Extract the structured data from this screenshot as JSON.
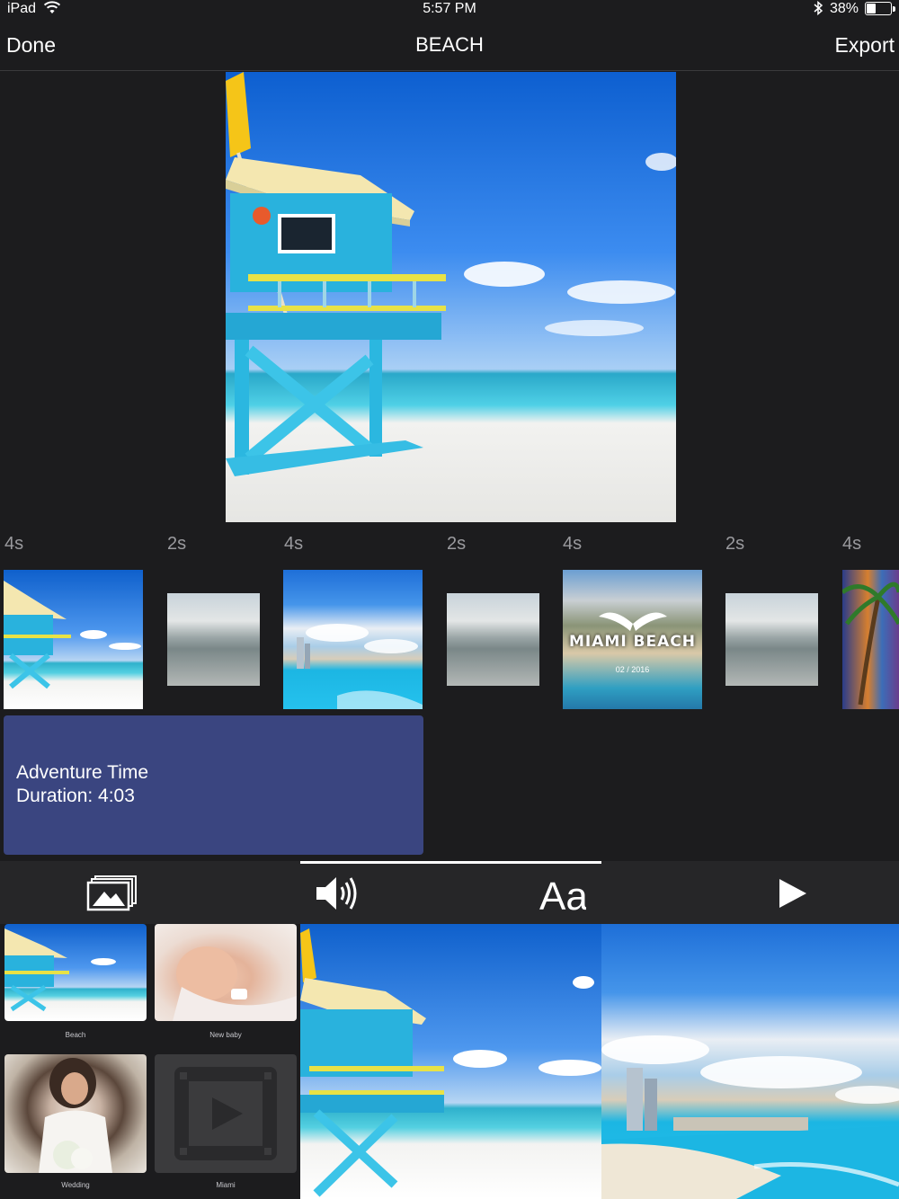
{
  "status_bar": {
    "device": "iPad",
    "time": "5:57 PM",
    "battery_percent": "38%",
    "battery_level": 0.38
  },
  "nav": {
    "left_button": "Done",
    "title": "BEACH",
    "right_button": "Export"
  },
  "timeline": {
    "durations": [
      "4s",
      "2s",
      "4s",
      "2s",
      "4s",
      "2s",
      "4s"
    ],
    "clips": [
      {
        "kind": "photo",
        "scene": "lifeguard tower on beach"
      },
      {
        "kind": "transition"
      },
      {
        "kind": "photo",
        "scene": "ocean shoreline with skyline"
      },
      {
        "kind": "transition"
      },
      {
        "kind": "title-photo",
        "title": "MIAMI BEACH",
        "date": "02 / 2016"
      },
      {
        "kind": "transition"
      },
      {
        "kind": "photo",
        "scene": "palm trees at night"
      }
    ]
  },
  "project": {
    "name": "Adventure Time",
    "duration": "Duration: 4:03"
  },
  "toolbar": {
    "tabs": [
      "photos",
      "audio",
      "text",
      "play"
    ],
    "selected": "text"
  },
  "library": {
    "albums": [
      {
        "label": "Beach"
      },
      {
        "label": "New baby"
      },
      {
        "label": "Wedding"
      },
      {
        "label": "Miami"
      }
    ]
  },
  "colors": {
    "background": "#1c1c1e",
    "project_card": "#3a4580",
    "toolbar": "#262628",
    "muted_text": "#9a9a9e"
  }
}
